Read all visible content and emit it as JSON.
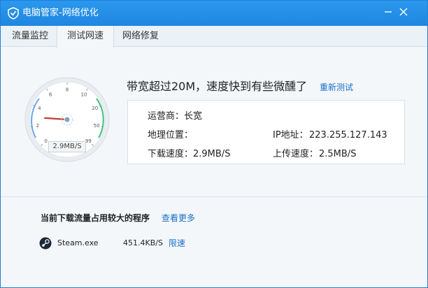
{
  "window": {
    "title": "电脑管家-网络优化",
    "minimize_icon": "minimize-icon",
    "close_icon": "close-icon"
  },
  "tabs": [
    {
      "label": "流量监控",
      "active": false
    },
    {
      "label": "测试网速",
      "active": true
    },
    {
      "label": "网络修复",
      "active": false
    }
  ],
  "gauge": {
    "readout": "2.9MB/S",
    "ticks": [
      "0",
      "2",
      "4",
      "6",
      "8",
      "10",
      "20",
      "50",
      "99"
    ],
    "speed_mb": 2.9
  },
  "result": {
    "headline": "带宽超过20M，速度快到有些微醺了",
    "retest_link": "重新测试"
  },
  "info": {
    "isp_label": "运营商：",
    "isp_value": "长宽",
    "location_label": "地理位置：",
    "location_value": "",
    "ip_label": "IP地址：",
    "ip_value": "223.255.127.143",
    "download_label": "下载速度：",
    "download_value": "2.9MB/S",
    "upload_label": "上传速度：",
    "upload_value": "2.5MB/S"
  },
  "programs": {
    "title": "当前下载流量占用较大的程序",
    "more_link": "查看更多",
    "items": [
      {
        "name": "Steam.exe",
        "rate": "451.4KB/S",
        "action": "限速",
        "icon": "steam-icon"
      }
    ]
  },
  "colors": {
    "titlebar": "#2090e6",
    "link": "#1a6fc9",
    "gauge_needle": "#c0392b",
    "gauge_arc_low": "#6aa6e8",
    "gauge_arc_high": "#3cc47a"
  }
}
